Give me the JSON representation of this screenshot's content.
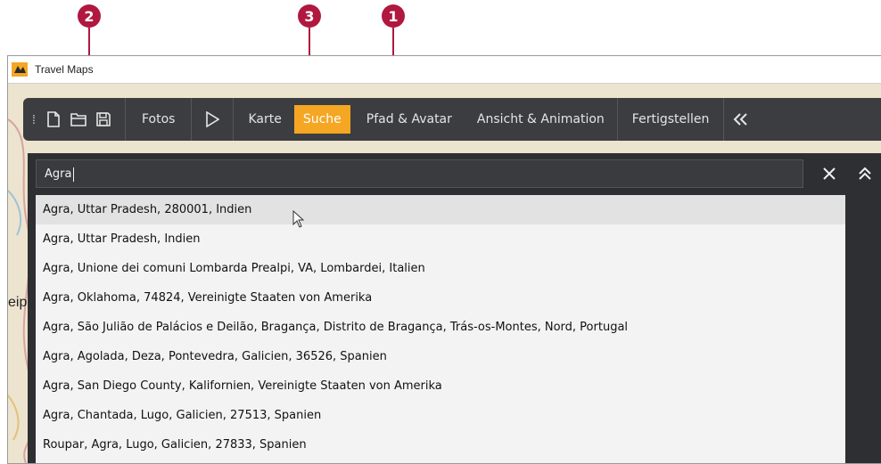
{
  "window": {
    "title": "Travel Maps"
  },
  "callouts": [
    {
      "number": "1"
    },
    {
      "number": "2"
    },
    {
      "number": "3"
    }
  ],
  "toolbar": {
    "grip_icon": "grip-dots-icon",
    "file_icons": [
      "new-file-icon",
      "open-folder-icon",
      "save-icon"
    ],
    "buttons": [
      {
        "label": "Fotos",
        "active": false
      },
      {
        "label": "Karte",
        "active": false
      },
      {
        "label": "Suche",
        "active": true
      },
      {
        "label": "Pfad & Avatar",
        "active": false
      },
      {
        "label": "Ansicht & Animation",
        "active": false
      },
      {
        "label": "Fertigstellen",
        "active": false
      }
    ],
    "play_icon": "play-icon",
    "collapse_icon": "double-chevron-left-icon",
    "active_color": "#f5a623"
  },
  "map": {
    "partial_label": "eip"
  },
  "search": {
    "value": "Agra",
    "clear_icon": "close-icon",
    "collapse_icon": "chevron-up-icon",
    "results": [
      "Agra, Uttar Pradesh, 280001, Indien",
      "Agra, Uttar Pradesh, Indien",
      "Agra, Unione dei comuni Lombarda Prealpi, VA, Lombardei, Italien",
      "Agra, Oklahoma, 74824, Vereinigte Staaten von Amerika",
      "Agra, São Julião de Palácios e Deilão, Bragança, Distrito de Bragança, Trás-os-Montes, Nord, Portugal",
      "Agra, Agolada, Deza, Pontevedra, Galicien, 36526, Spanien",
      "Agra, San Diego County, Kalifornien, Vereinigte Staaten von Amerika",
      "Agra, Chantada, Lugo, Galicien, 27513, Spanien",
      "Roupar, Agra, Lugo, Galicien, 27833, Spanien"
    ]
  },
  "colors": {
    "callout": "#b0183f",
    "toolbar_bg": "#3c3d40",
    "panel_bg": "#2e2f32"
  }
}
